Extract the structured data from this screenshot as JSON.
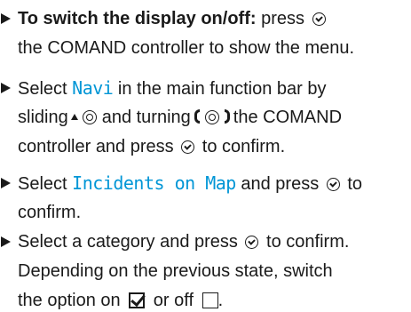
{
  "steps": [
    {
      "lines": [
        {
          "bold": "To switch the display on/off:",
          "text_after_bold": " press",
          "text_after_icon": "the COMAND controller to show the menu."
        }
      ]
    },
    {
      "line1_before": "Select",
      "line1_code": "Navi",
      "line1_after": "in the main function bar by",
      "line2_before": "sliding",
      "line2_mid": "and turning",
      "line2_after": "the COMAND",
      "line3_before": "controller and press",
      "line3_after": "to confirm."
    },
    {
      "line1_before": "Select",
      "line1_code": "Incidents on Map",
      "line1_after": "and press",
      "line1_tail": "to",
      "line2": "confirm."
    },
    {
      "line1_before": "Select a category and press",
      "line1_after": "to confirm.",
      "line2": "Depending on the previous state, switch",
      "line3_before": "the option on",
      "line3_mid": "or off",
      "line3_after": "."
    }
  ],
  "icons": {
    "press": "press-controller-icon",
    "slide": "slide-controller-up-icon",
    "turn": "turn-controller-icon",
    "checked": "checkbox-checked-icon",
    "unchecked": "checkbox-unchecked-icon"
  },
  "colors": {
    "text": "#1a1a1a",
    "display_term": "#0096d6"
  }
}
